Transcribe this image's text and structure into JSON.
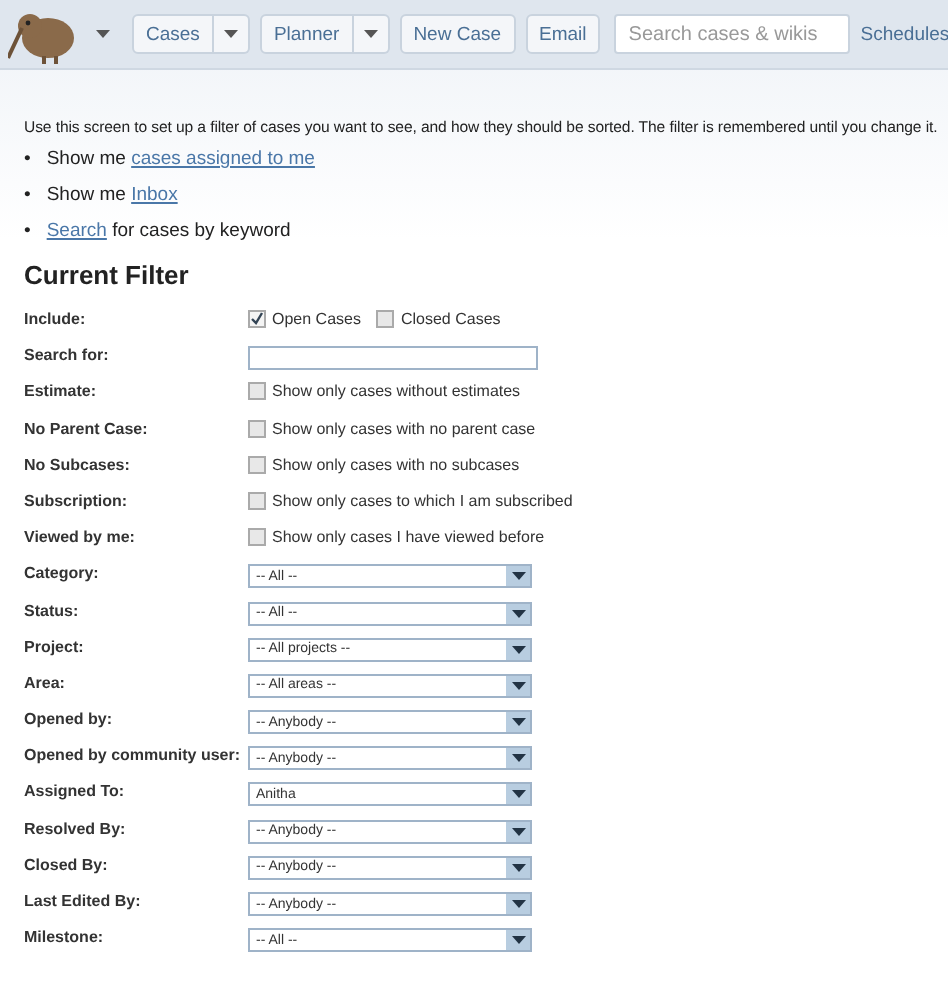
{
  "nav": [
    {
      "kind": "split",
      "label": "Cases"
    },
    {
      "kind": "split",
      "label": "Planner"
    },
    {
      "kind": "button",
      "label": "New Case"
    },
    {
      "kind": "button",
      "label": "Email"
    },
    {
      "kind": "search",
      "placeholder": "Search cases & wikis"
    },
    {
      "kind": "link",
      "label": "Schedules"
    }
  ],
  "intro": "Use this screen to set up a filter of cases you want to see, and how they should be sorted. The filter is remembered until you change it.",
  "shortcuts": [
    {
      "marker": "•",
      "before": "Show me ",
      "link": "cases assigned to me"
    },
    {
      "marker": "•",
      "before": "Show me ",
      "link": "Inbox"
    },
    {
      "marker": "•",
      "link": "Search",
      "after": " for cases by keyword"
    }
  ],
  "heading": "Current Filter",
  "rows": [
    {
      "label": "Include:",
      "kind": "checks",
      "options": [
        {
          "label": "Open Cases",
          "checked": true
        },
        {
          "label": "Closed Cases",
          "checked": false
        }
      ]
    },
    {
      "label": "Search for:",
      "kind": "text"
    },
    {
      "label": "Estimate:",
      "kind": "check",
      "options": [
        {
          "label": "Show only cases without estimates",
          "checked": false
        }
      ]
    },
    {
      "label": "No Parent Case:",
      "kind": "check",
      "options": [
        {
          "label": "Show only cases with no parent case",
          "checked": false
        }
      ]
    },
    {
      "label": "No Subcases:",
      "kind": "check",
      "options": [
        {
          "label": "Show only cases with no subcases",
          "checked": false
        }
      ]
    },
    {
      "label": "Subscription:",
      "kind": "check",
      "options": [
        {
          "label": "Show only cases to which I am subscribed",
          "checked": false
        }
      ]
    },
    {
      "label": "Viewed by me:",
      "kind": "check",
      "options": [
        {
          "label": "Show only cases I have viewed before",
          "checked": false
        }
      ]
    },
    {
      "label": "Category:",
      "kind": "select",
      "value": "-- All --"
    },
    {
      "label": "Status:",
      "kind": "select",
      "value": "-- All --"
    },
    {
      "label": "Project:",
      "kind": "select",
      "value": "-- All projects --"
    },
    {
      "label": "Area:",
      "kind": "select",
      "value": "-- All areas --"
    },
    {
      "label": "Opened by:",
      "kind": "select",
      "value": "-- Anybody --"
    },
    {
      "label": "Opened by community user:",
      "kind": "select",
      "value": "-- Anybody --"
    },
    {
      "label": "Assigned To:",
      "kind": "select",
      "value": "Anitha"
    },
    {
      "label": "Resolved By:",
      "kind": "select",
      "value": "-- Anybody --"
    },
    {
      "label": "Closed By:",
      "kind": "select",
      "value": "-- Anybody --"
    },
    {
      "label": "Last Edited By:",
      "kind": "select",
      "value": "-- Anybody --"
    },
    {
      "label": "Milestone:",
      "kind": "select",
      "value": "-- All --"
    }
  ]
}
